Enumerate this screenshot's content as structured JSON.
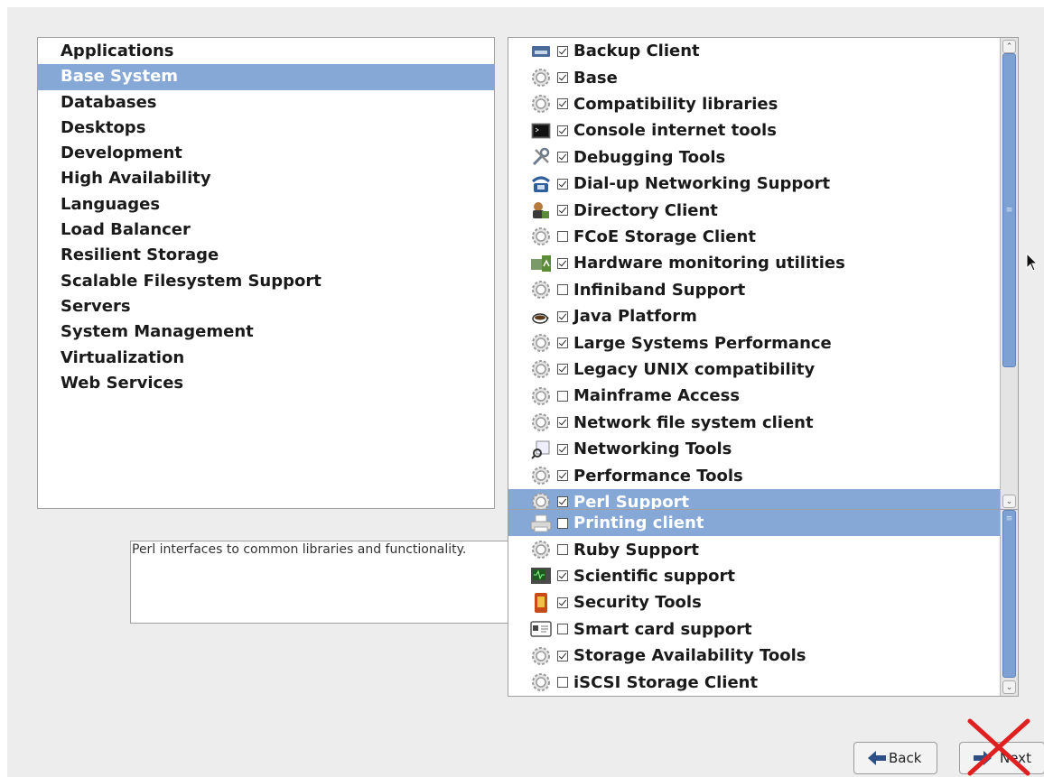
{
  "categories": [
    {
      "label": "Applications"
    },
    {
      "label": "Base System",
      "selected": true
    },
    {
      "label": "Databases"
    },
    {
      "label": "Desktops"
    },
    {
      "label": "Development"
    },
    {
      "label": "High Availability"
    },
    {
      "label": "Languages"
    },
    {
      "label": "Load Balancer"
    },
    {
      "label": "Resilient Storage"
    },
    {
      "label": "Scalable Filesystem Support"
    },
    {
      "label": "Servers"
    },
    {
      "label": "System Management"
    },
    {
      "label": "Virtualization"
    },
    {
      "label": "Web Services"
    }
  ],
  "description": "Perl interfaces to common libraries and functionality.",
  "packages_upper": [
    {
      "label": "Backup Client",
      "checked": true,
      "icon": "backup-icon"
    },
    {
      "label": "Base",
      "checked": true,
      "icon": "gear-icon"
    },
    {
      "label": "Compatibility libraries",
      "checked": true,
      "icon": "gear-icon"
    },
    {
      "label": "Console internet tools",
      "checked": true,
      "icon": "terminal-icon"
    },
    {
      "label": "Debugging Tools",
      "checked": true,
      "icon": "tools-icon"
    },
    {
      "label": "Dial-up Networking Support",
      "checked": true,
      "icon": "phone-icon"
    },
    {
      "label": "Directory Client",
      "checked": true,
      "icon": "directory-icon"
    },
    {
      "label": "FCoE Storage Client",
      "checked": false,
      "icon": "gear-icon"
    },
    {
      "label": "Hardware monitoring utilities",
      "checked": true,
      "icon": "monitor-icon"
    },
    {
      "label": "Infiniband Support",
      "checked": false,
      "icon": "gear-icon"
    },
    {
      "label": "Java Platform",
      "checked": true,
      "icon": "coffee-icon"
    },
    {
      "label": "Large Systems Performance",
      "checked": true,
      "icon": "gear-icon"
    },
    {
      "label": "Legacy UNIX compatibility",
      "checked": true,
      "icon": "gear-icon"
    },
    {
      "label": "Mainframe Access",
      "checked": false,
      "icon": "gear-icon"
    },
    {
      "label": "Network file system client",
      "checked": true,
      "icon": "gear-icon"
    },
    {
      "label": "Networking Tools",
      "checked": true,
      "icon": "network-search-icon"
    },
    {
      "label": "Performance Tools",
      "checked": true,
      "icon": "gear-icon"
    },
    {
      "label": "Perl Support",
      "checked": true,
      "icon": "gear-icon",
      "selected": true
    }
  ],
  "packages_lower": [
    {
      "label": "Printing client",
      "checked": false,
      "icon": "printer-icon",
      "selected": true
    },
    {
      "label": "Ruby Support",
      "checked": false,
      "icon": "gear-icon"
    },
    {
      "label": "Scientific support",
      "checked": true,
      "icon": "oscilloscope-icon"
    },
    {
      "label": "Security Tools",
      "checked": true,
      "icon": "security-icon"
    },
    {
      "label": "Smart card support",
      "checked": false,
      "icon": "smartcard-icon"
    },
    {
      "label": "Storage Availability Tools",
      "checked": true,
      "icon": "gear-icon"
    },
    {
      "label": "iSCSI Storage Client",
      "checked": false,
      "icon": "gear-icon"
    }
  ],
  "buttons": {
    "back": "Back",
    "next": "Next"
  },
  "colors": {
    "selection": "#86a8d6",
    "scroll_thumb": "#7ea1d4",
    "background": "#ededed",
    "annotation_x": "#e02020"
  }
}
